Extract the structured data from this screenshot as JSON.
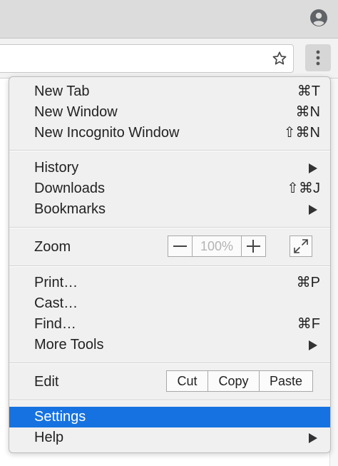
{
  "icons": {
    "profile": "account-circle-icon",
    "bookmark_star": "star-outline-icon",
    "menu": "three-dots-vertical-icon",
    "fullscreen": "fullscreen-icon",
    "submenu_arrow": "triangle-right-icon"
  },
  "colors": {
    "selection": "#1672e0",
    "menu_background": "#f0f0f0",
    "titlebar": "#dcdcdc"
  },
  "menu": {
    "groups": [
      {
        "items": [
          {
            "label": "New Tab",
            "shortcut": "⌘T"
          },
          {
            "label": "New Window",
            "shortcut": "⌘N"
          },
          {
            "label": "New Incognito Window",
            "shortcut": "⇧⌘N"
          }
        ]
      },
      {
        "items": [
          {
            "label": "History",
            "submenu": true
          },
          {
            "label": "Downloads",
            "shortcut": "⇧⌘J"
          },
          {
            "label": "Bookmarks",
            "submenu": true
          }
        ]
      },
      {
        "zoom": {
          "label": "Zoom",
          "minus": "−",
          "value": "100%",
          "plus": "+"
        }
      },
      {
        "items": [
          {
            "label": "Print…",
            "shortcut": "⌘P"
          },
          {
            "label": "Cast…"
          },
          {
            "label": "Find…",
            "shortcut": "⌘F"
          },
          {
            "label": "More Tools",
            "submenu": true
          }
        ]
      },
      {
        "edit": {
          "label": "Edit",
          "cut": "Cut",
          "copy": "Copy",
          "paste": "Paste"
        }
      },
      {
        "items": [
          {
            "label": "Settings",
            "selected": true
          },
          {
            "label": "Help",
            "submenu": true
          }
        ]
      }
    ]
  }
}
